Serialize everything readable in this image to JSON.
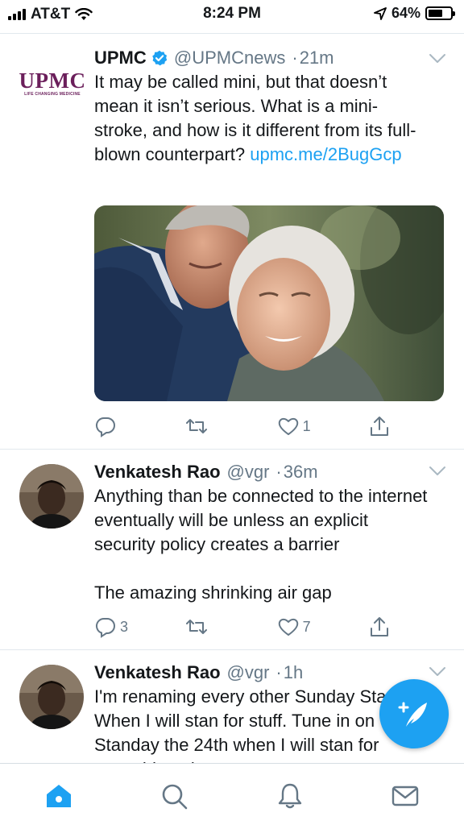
{
  "status_bar": {
    "carrier": "AT&T",
    "time": "8:24 PM",
    "battery": "64%",
    "battery_level": 0.64
  },
  "tweets": [
    {
      "name": "UPMC",
      "verified": true,
      "handle": "@UPMCnews",
      "time": "21m",
      "logo_text": "UPMC",
      "logo_tagline": "LIFE CHANGING MEDICINE",
      "text": "It may be called mini, but that doesn’t mean it isn’t serious. What is a mini-stroke, and how is it different from its full-blown counterpart?",
      "link": "upmc.me/2BugGcp",
      "replies": "",
      "retweets": "",
      "likes": "1"
    },
    {
      "name": "Venkatesh Rao",
      "verified": false,
      "handle": "@vgr",
      "time": "36m",
      "text": "Anything than be connected to the internet eventually will be unless an explicit security policy creates a barrier\n\nThe amazing shrinking air gap",
      "replies": "3",
      "retweets": "",
      "likes": "7"
    },
    {
      "name": "Venkatesh Rao",
      "verified": false,
      "handle": "@vgr",
      "time": "1h",
      "text": "I'm renaming every other Sunday Standay. When I will stan for stuff. Tune in on Standay the 24th when I will stan for something else"
    }
  ],
  "colors": {
    "accent": "#1da1f2",
    "upmc_purple": "#6b1f5b",
    "secondary_text": "#657786"
  },
  "icons": {
    "reply": "reply-icon",
    "retweet": "retweet-icon",
    "like": "heart-icon",
    "share": "share-icon",
    "compose": "compose-tweet-icon",
    "home": "home-icon",
    "search": "search-icon",
    "notifications": "bell-icon",
    "messages": "mail-icon"
  }
}
